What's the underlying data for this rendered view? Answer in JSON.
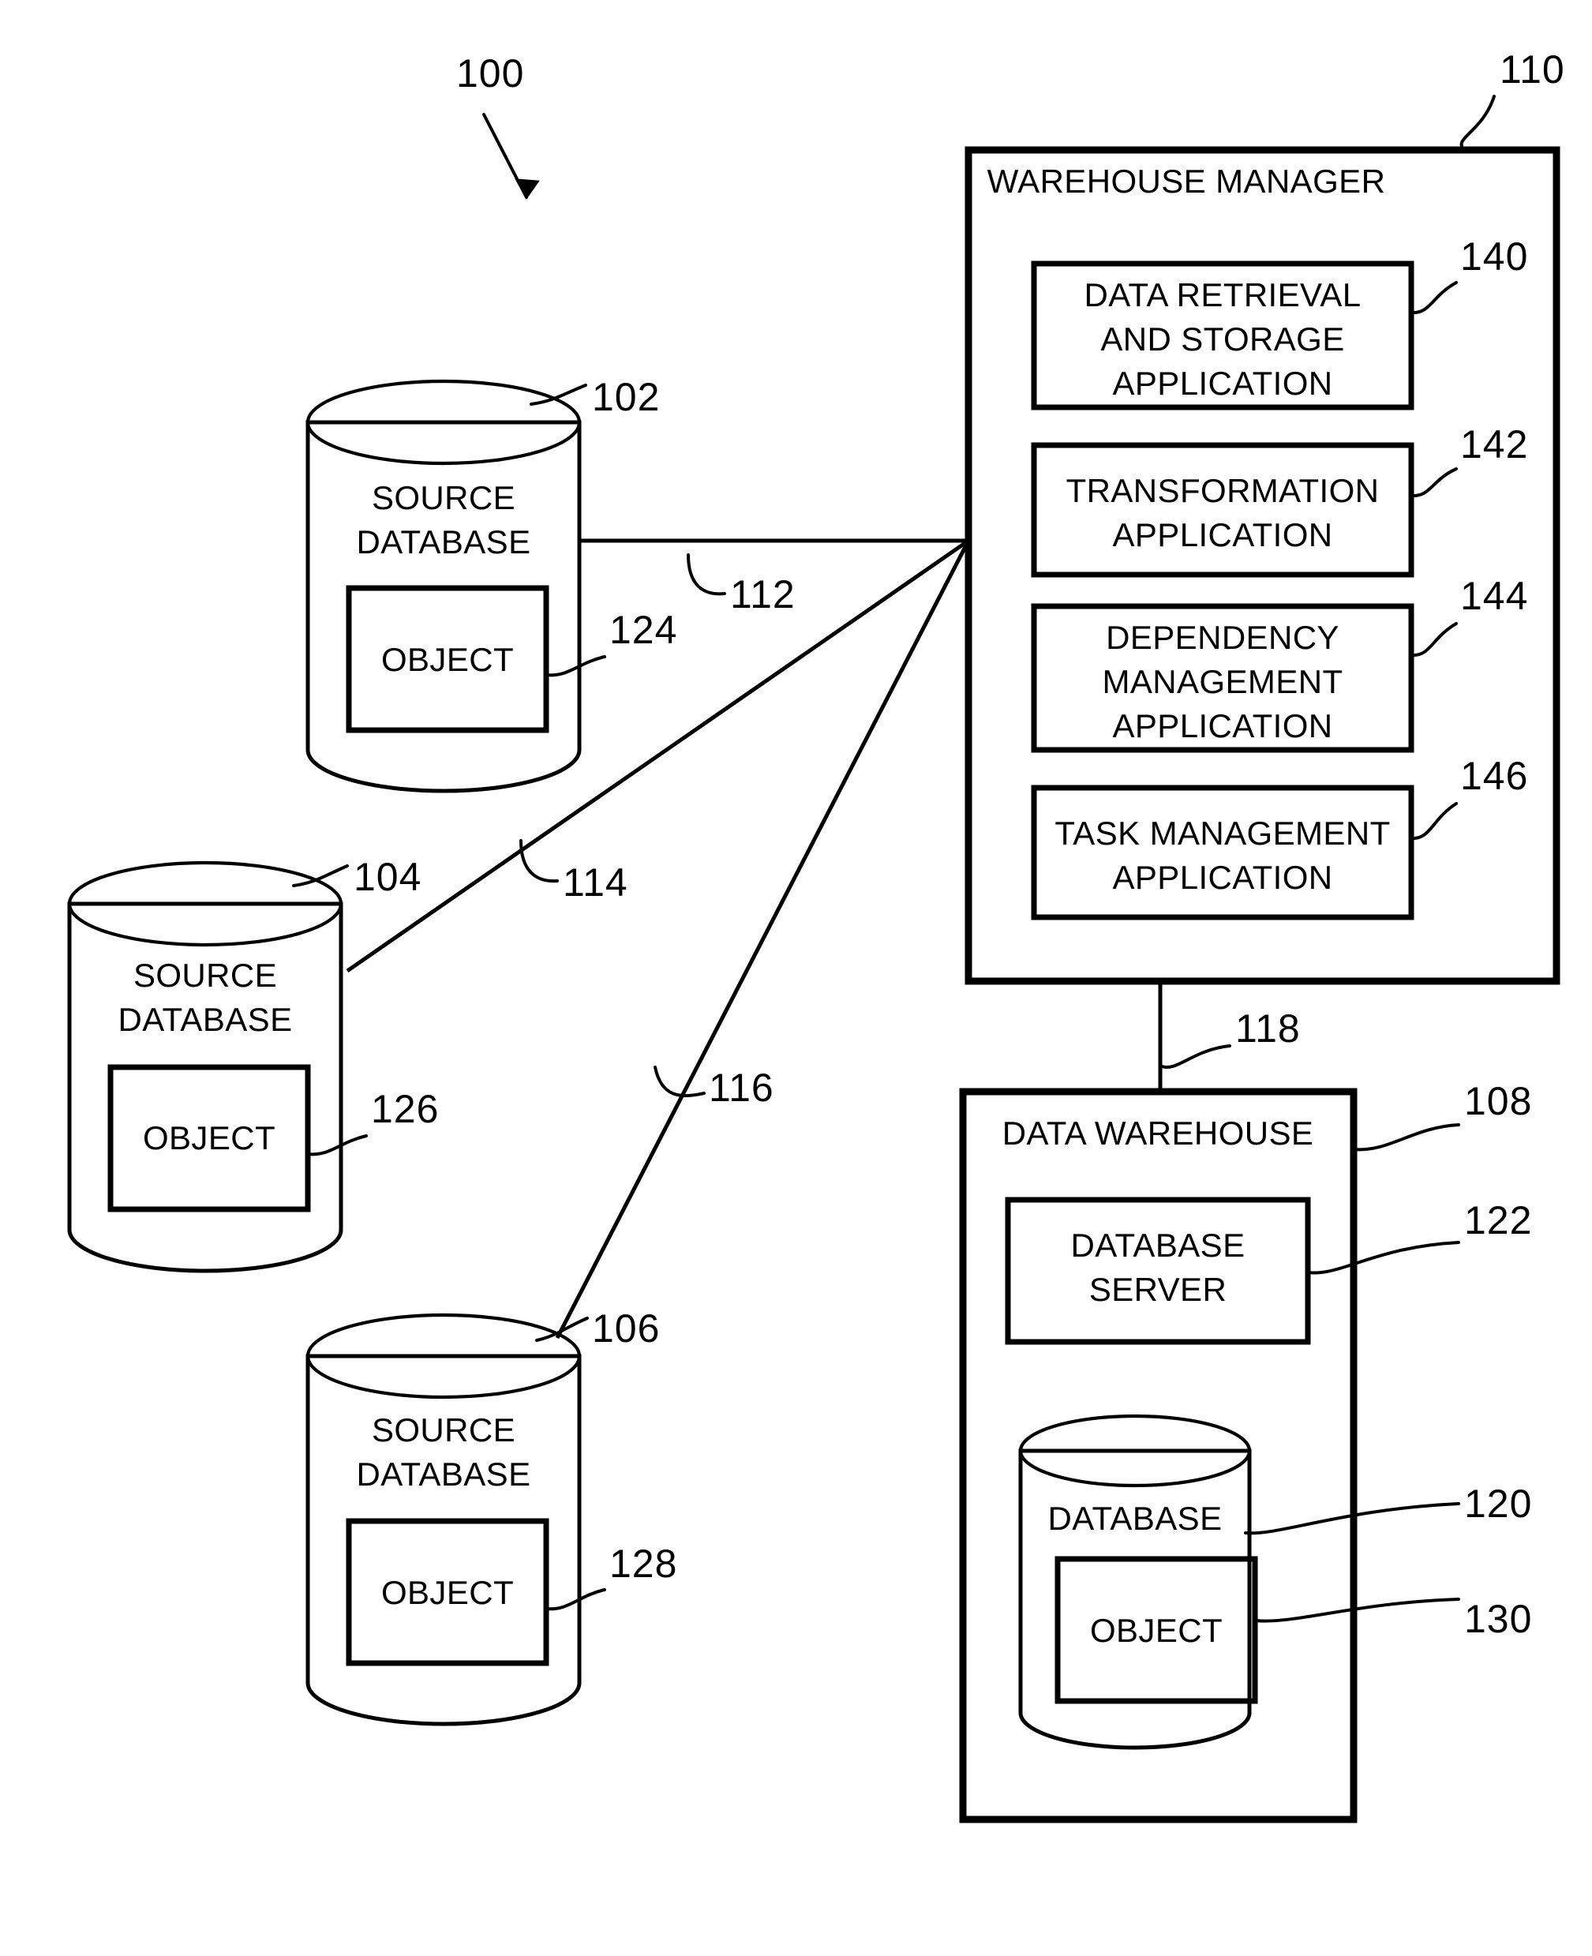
{
  "figure": {
    "figure_ref": "100",
    "background_color": "#ffffff",
    "line_color": "#000000"
  },
  "warehouse_manager": {
    "title": "WAREHOUSE MANAGER",
    "ref": "110",
    "applications": [
      {
        "label_line1": "DATA RETRIEVAL",
        "label_line2": "AND STORAGE",
        "label_line3": "APPLICATION",
        "ref": "140"
      },
      {
        "label_line1": "TRANSFORMATION",
        "label_line2": "APPLICATION",
        "label_line3": "",
        "ref": "142"
      },
      {
        "label_line1": "DEPENDENCY",
        "label_line2": "MANAGEMENT",
        "label_line3": "APPLICATION",
        "ref": "144"
      },
      {
        "label_line1": "TASK MANAGEMENT",
        "label_line2": "APPLICATION",
        "label_line3": "",
        "ref": "146"
      }
    ]
  },
  "source_databases": [
    {
      "label_line1": "SOURCE",
      "label_line2": "DATABASE",
      "ref": "102",
      "object_label": "OBJECT",
      "object_ref": "124",
      "connection_ref": "112"
    },
    {
      "label_line1": "SOURCE",
      "label_line2": "DATABASE",
      "ref": "104",
      "object_label": "OBJECT",
      "object_ref": "126",
      "connection_ref": "114"
    },
    {
      "label_line1": "SOURCE",
      "label_line2": "DATABASE",
      "ref": "106",
      "object_label": "OBJECT",
      "object_ref": "128",
      "connection_ref": "116"
    }
  ],
  "data_warehouse": {
    "title": "DATA WAREHOUSE",
    "ref": "108",
    "connection_ref": "118",
    "database_server": {
      "label_line1": "DATABASE",
      "label_line2": "SERVER",
      "ref": "122"
    },
    "database": {
      "label": "DATABASE",
      "ref": "120",
      "object_label": "OBJECT",
      "object_ref": "130"
    }
  }
}
